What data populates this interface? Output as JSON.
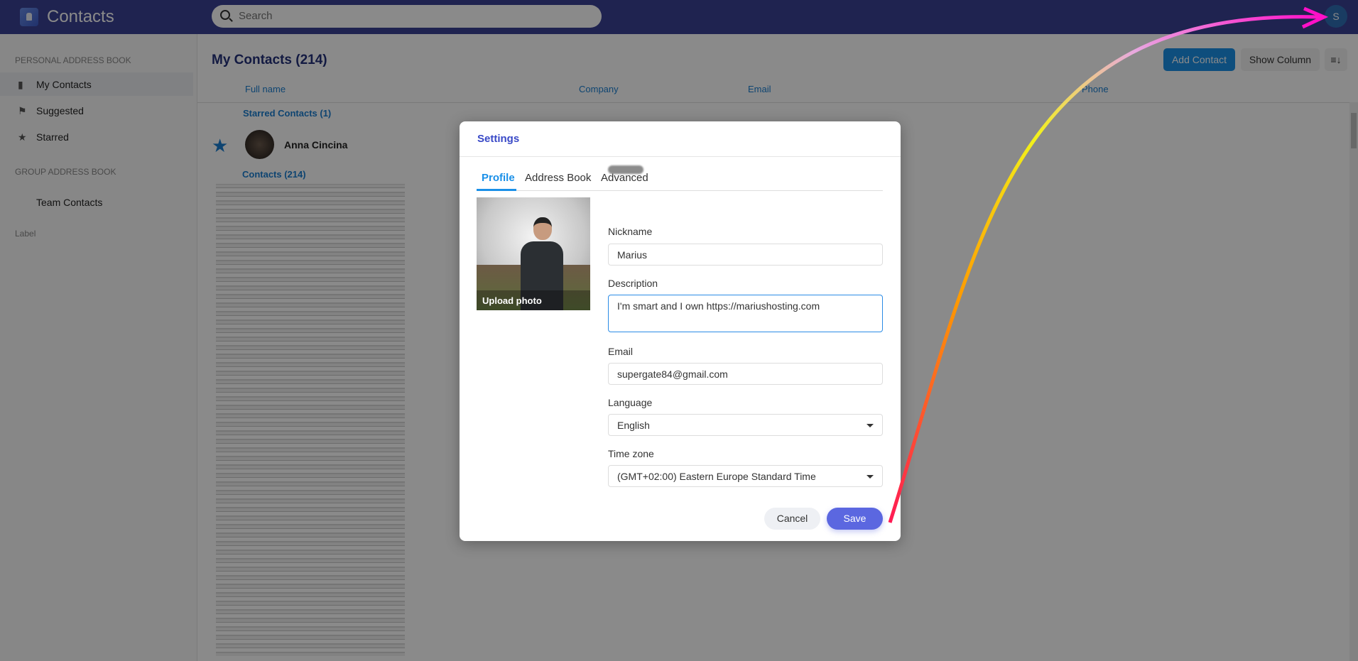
{
  "header": {
    "app_title": "Contacts",
    "search_placeholder": "Search",
    "user_initial": "S"
  },
  "sidebar": {
    "personal_section": "PERSONAL ADDRESS BOOK",
    "items": [
      {
        "label": "My Contacts",
        "icon": "book-icon",
        "selected": true
      },
      {
        "label": "Suggested",
        "icon": "flag-icon"
      },
      {
        "label": "Starred",
        "icon": "star-icon"
      }
    ],
    "group_section": "GROUP ADDRESS BOOK",
    "group_items": [
      {
        "label": "Team Contacts"
      }
    ],
    "label_section": "Label"
  },
  "main": {
    "title": "My Contacts (214)",
    "add_contact": "Add Contact",
    "show_column": "Show Column",
    "sort_icon": "sort-icon",
    "columns": [
      "Full name",
      "Company",
      "Email",
      "Phone"
    ],
    "starred_group": "Starred Contacts (1)",
    "starred_contact": "Anna Cincina",
    "contacts_group": "Contacts (214)"
  },
  "modal": {
    "title": "Settings",
    "tabs": [
      "Profile",
      "Address Book",
      "Advanced"
    ],
    "active_tab": "Profile",
    "upload_photo": "Upload photo",
    "nickname_label": "Nickname",
    "nickname": "Marius",
    "description_label": "Description",
    "description": "I'm smart and I own https://mariushosting.com",
    "email_label": "Email",
    "email": "supergate84@gmail.com",
    "language_label": "Language",
    "language": "English",
    "timezone_label": "Time zone",
    "timezone": "(GMT+02:00) Eastern Europe Standard Time",
    "cancel": "Cancel",
    "save": "Save"
  },
  "colors": {
    "accent": "#1a90e8",
    "save": "#5b67e0",
    "header": "#3a4294"
  }
}
